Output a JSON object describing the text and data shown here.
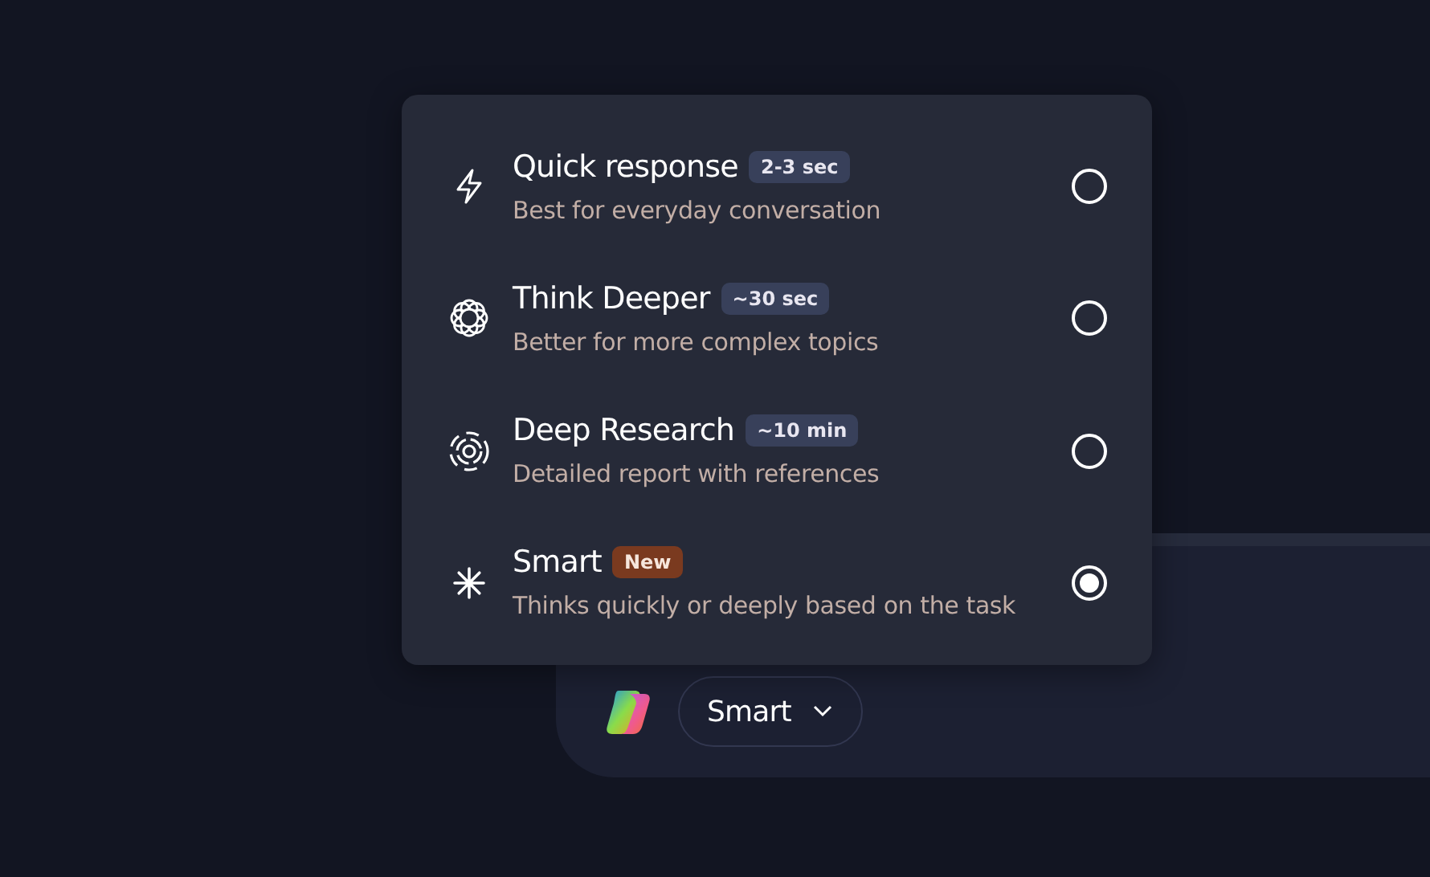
{
  "mode_menu": {
    "options": [
      {
        "title": "Quick response",
        "badge": {
          "text": "2-3 sec",
          "kind": "time"
        },
        "description": "Best for everyday conversation",
        "selected": false
      },
      {
        "title": "Think Deeper",
        "badge": {
          "text": "~30 sec",
          "kind": "time"
        },
        "description": "Better for more complex topics",
        "selected": false
      },
      {
        "title": "Deep Research",
        "badge": {
          "text": "~10 min",
          "kind": "time"
        },
        "description": "Detailed report with references",
        "selected": false
      },
      {
        "title": "Smart",
        "badge": {
          "text": "New",
          "kind": "new"
        },
        "description": "Thinks quickly or deeply based on the task",
        "selected": true
      }
    ]
  },
  "composer": {
    "mode_button": {
      "label": "Smart"
    }
  }
}
